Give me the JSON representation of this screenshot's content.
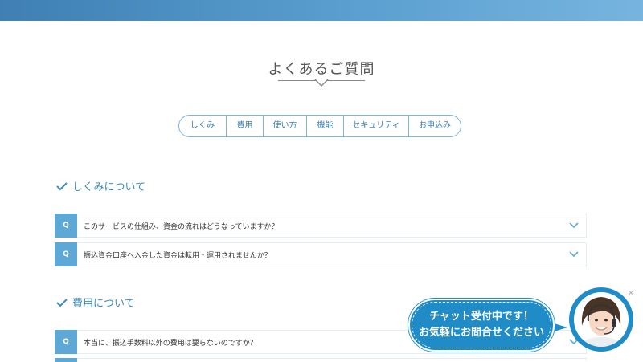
{
  "page": {
    "title": "よくあるご質問"
  },
  "tabs": [
    "しくみ",
    "費用",
    "使い方",
    "機能",
    "セキュリティ",
    "お申込み"
  ],
  "sections": [
    {
      "heading": "しくみについて",
      "questions": [
        "このサービスの仕組み、資金の流れはどうなっていますか？",
        "振込資金口座へ入金した資金は転用・運用されませんか？"
      ]
    },
    {
      "heading": "費用について",
      "questions": [
        "本当に、振込手数料以外の費用は要らないのですか？"
      ]
    }
  ],
  "faq_marker": "Q",
  "chat": {
    "line1": "チャット受付中です！",
    "line2": "お気軽にお問合せください",
    "close_glyph": "×"
  },
  "colors": {
    "accent": "#3d8cc2",
    "q_badge": "#5ea8d6",
    "chat_blue": "#1f8cc8"
  }
}
